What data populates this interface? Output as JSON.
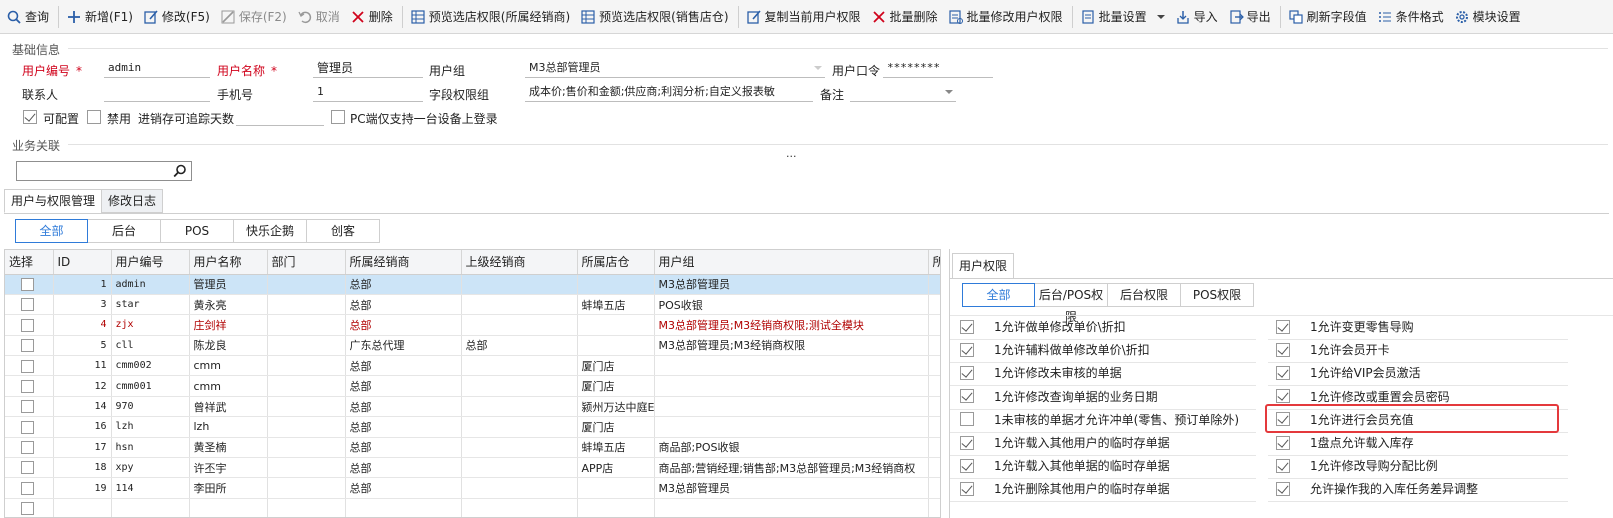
{
  "toolbar": {
    "items": [
      {
        "label": "查询",
        "icon": "search-icon",
        "disabled": false
      },
      {
        "label": "新增(F1)",
        "icon": "plus-icon",
        "disabled": false
      },
      {
        "label": "修改(F5)",
        "icon": "edit-icon",
        "disabled": false
      },
      {
        "label": "保存(F2)",
        "icon": "save-icon",
        "disabled": true
      },
      {
        "label": "取消",
        "icon": "undo-icon",
        "disabled": true
      },
      {
        "label": "删除",
        "icon": "delete-icon",
        "disabled": false
      },
      {
        "label": "预览选店权限(所属经销商)",
        "icon": "grid-icon",
        "disabled": false
      },
      {
        "label": "预览选店权限(销售店仓)",
        "icon": "grid-icon",
        "disabled": false
      },
      {
        "label": "复制当前用户权限",
        "icon": "copy-edit-icon",
        "disabled": false
      },
      {
        "label": "批量删除",
        "icon": "delete-icon",
        "disabled": false
      },
      {
        "label": "批量修改用户权限",
        "icon": "batch-edit-icon",
        "disabled": false
      },
      {
        "label": "批量设置",
        "icon": "doc-icon",
        "disabled": false
      },
      {
        "label": "导入",
        "icon": "import-icon",
        "disabled": false
      },
      {
        "label": "导出",
        "icon": "export-icon",
        "disabled": false
      },
      {
        "label": "刷新字段值",
        "icon": "refresh-icon",
        "disabled": false
      },
      {
        "label": "条件格式",
        "icon": "list-icon",
        "disabled": false
      },
      {
        "label": "模块设置",
        "icon": "gear-icon",
        "disabled": false
      }
    ]
  },
  "basic": {
    "section_title": "基础信息",
    "user_code_label": "用户编号",
    "user_code": "admin",
    "user_name_label": "用户名称",
    "user_name": "管理员",
    "group_label": "用户组",
    "group": "M3总部管理员",
    "password_label": "用户口令",
    "password": "********",
    "contact_label": "联系人",
    "contact": "",
    "phone_label": "手机号",
    "phone": "1",
    "field_perm_label": "字段权限组",
    "field_perm": "成本价;售价和金额;供应商;利润分析;自定义报表敏",
    "remark_label": "备注",
    "remark": "",
    "configurable_label": "可配置",
    "disabled_label": "禁用",
    "trace_days_label": "进销存可追踪天数",
    "trace_days": "",
    "pc_single_label": "PC端仅支持一台设备上登录",
    "required_mark": "*"
  },
  "business": {
    "section_title": "业务关联",
    "search_value": "",
    "ellipsis": "..."
  },
  "tabs": [
    {
      "label": "用户与权限管理",
      "active": true
    },
    {
      "label": "修改日志",
      "active": false
    }
  ],
  "filter_tabs": [
    {
      "label": "全部",
      "active": true
    },
    {
      "label": "后台",
      "active": false
    },
    {
      "label": "POS",
      "active": false
    },
    {
      "label": "快乐企鹅",
      "active": false
    },
    {
      "label": "创客",
      "active": false
    }
  ],
  "table": {
    "columns": [
      "选择",
      "ID",
      "用户编号",
      "用户名称",
      "部门",
      "所属经销商",
      "上级经销商",
      "所属店仓",
      "用户组",
      "所"
    ],
    "rows": [
      {
        "id": "1",
        "code": "admin",
        "name": "管理员",
        "dept": "",
        "dealer": "总部",
        "parent": "",
        "store": "",
        "group": "M3总部管理员",
        "selected": true,
        "red": false
      },
      {
        "id": "3",
        "code": "star",
        "name": "黄永亮",
        "dept": "",
        "dealer": "总部",
        "parent": "",
        "store": "蚌埠五店",
        "group": "POS收银",
        "selected": false,
        "red": false
      },
      {
        "id": "4",
        "code": "zjx",
        "name": "庄剑祥",
        "dept": "",
        "dealer": "总部",
        "parent": "",
        "store": "",
        "group": "M3总部管理员;M3经销商权限;测试全模块",
        "selected": false,
        "red": true
      },
      {
        "id": "5",
        "code": "cll",
        "name": "陈龙良",
        "dept": "",
        "dealer": "广东总代理",
        "parent": "总部",
        "store": "",
        "group": "M3总部管理员;M3经销商权限",
        "selected": false,
        "red": false
      },
      {
        "id": "11",
        "code": "cmm002",
        "name": "cmm",
        "dept": "",
        "dealer": "总部",
        "parent": "",
        "store": "厦门店",
        "group": "",
        "selected": false,
        "red": false
      },
      {
        "id": "12",
        "code": "cmm001",
        "name": "cmm",
        "dept": "",
        "dealer": "总部",
        "parent": "",
        "store": "厦门店",
        "group": "",
        "selected": false,
        "red": false
      },
      {
        "id": "14",
        "code": "970",
        "name": "曾祥武",
        "dept": "",
        "dealer": "总部",
        "parent": "",
        "store": "颍州万达中庭E",
        "group": "",
        "selected": false,
        "red": false
      },
      {
        "id": "16",
        "code": "lzh",
        "name": "lzh",
        "dept": "",
        "dealer": "总部",
        "parent": "",
        "store": "厦门店",
        "group": "",
        "selected": false,
        "red": false
      },
      {
        "id": "17",
        "code": "hsn",
        "name": "黄圣楠",
        "dept": "",
        "dealer": "总部",
        "parent": "",
        "store": "蚌埠五店",
        "group": "商品部;POS收银",
        "selected": false,
        "red": false
      },
      {
        "id": "18",
        "code": "xpy",
        "name": "许丕宇",
        "dept": "",
        "dealer": "总部",
        "parent": "",
        "store": "APP店",
        "group": "商品部;营销经理;销售部;M3总部管理员;M3经销商权",
        "selected": false,
        "red": false
      },
      {
        "id": "19",
        "code": "114",
        "name": "李田所",
        "dept": "",
        "dealer": "总部",
        "parent": "",
        "store": "",
        "group": "M3总部管理员",
        "selected": false,
        "red": false
      },
      {
        "id": "",
        "code": "",
        "name": "",
        "dept": "",
        "dealer": "",
        "parent": "",
        "store": "",
        "group": "",
        "selected": false,
        "red": false
      }
    ]
  },
  "permissions": {
    "tab_label": "用户权限",
    "filters": [
      {
        "label": "全部",
        "active": true
      },
      {
        "label": "后台/POS权限",
        "active": false
      },
      {
        "label": "后台权限",
        "active": false
      },
      {
        "label": "POS权限",
        "active": false
      }
    ],
    "left": [
      {
        "label": "1允许做单修改单价\\折扣",
        "checked": true
      },
      {
        "label": "1允许辅料做单修改单价\\折扣",
        "checked": true
      },
      {
        "label": "1允许修改未审核的单据",
        "checked": true
      },
      {
        "label": "1允许修改查询单据的业务日期",
        "checked": true
      },
      {
        "label": "1未审核的单据才允许冲单(零售、预订单除外)",
        "checked": false
      },
      {
        "label": "1允许载入其他用户的临时存单据",
        "checked": true
      },
      {
        "label": "1允许载入其他单据的临时存单据",
        "checked": true
      },
      {
        "label": "1允许删除其他用户的临时存单据",
        "checked": true
      }
    ],
    "right": [
      {
        "label": "1允许变更零售导购",
        "checked": true
      },
      {
        "label": "1允许会员开卡",
        "checked": true
      },
      {
        "label": "1允许给VIP会员激活",
        "checked": true
      },
      {
        "label": "1允许修改或重置会员密码",
        "checked": true
      },
      {
        "label": "1允许进行会员充值",
        "checked": true
      },
      {
        "label": "1盘点允许载入库存",
        "checked": true
      },
      {
        "label": "1允许修改导购分配比例",
        "checked": true
      },
      {
        "label": "允许操作我的入库任务差异调整",
        "checked": true
      }
    ]
  },
  "colors": {
    "accent": "#2f7bd9",
    "required": "#d0021b",
    "highlight": "#e4393c",
    "selected_row": "#cce4f7"
  }
}
